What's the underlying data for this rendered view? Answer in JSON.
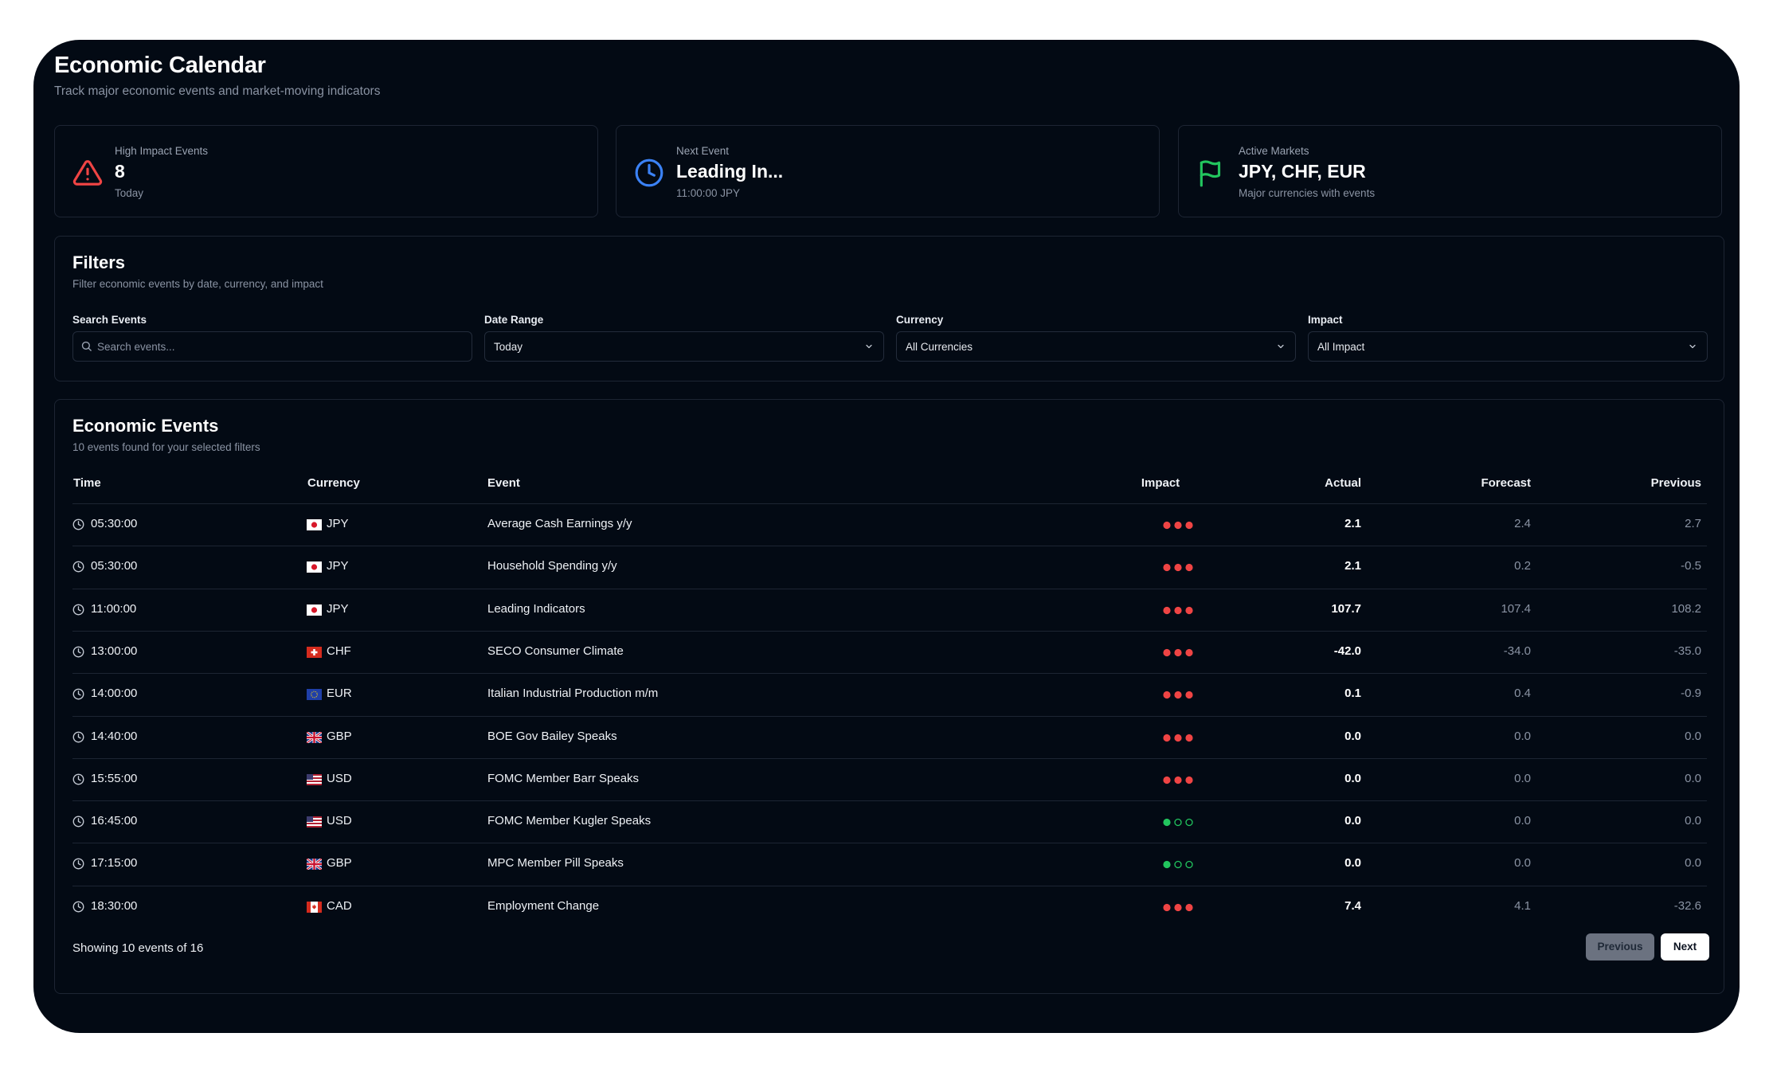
{
  "header": {
    "title": "Economic Calendar",
    "subtitle": "Track major economic events and market-moving indicators"
  },
  "stats": [
    {
      "label": "High Impact Events",
      "value": "8",
      "sub": "Today",
      "icon": "warning-triangle-icon",
      "color": "#ef4444"
    },
    {
      "label": "Next Event",
      "value": "Leading In...",
      "sub": "11:00:00 JPY",
      "icon": "clock-icon",
      "color": "#3b82f6"
    },
    {
      "label": "Active Markets",
      "value": "JPY, CHF, EUR",
      "sub": "Major currencies with events",
      "icon": "flag-icon",
      "color": "#22c55e"
    }
  ],
  "filters": {
    "title": "Filters",
    "subtitle": "Filter economic events by date, currency, and impact",
    "search": {
      "label": "Search Events",
      "placeholder": "Search events..."
    },
    "date_range": {
      "label": "Date Range",
      "value": "Today"
    },
    "currency": {
      "label": "Currency",
      "value": "All Currencies"
    },
    "impact": {
      "label": "Impact",
      "value": "All Impact"
    }
  },
  "events": {
    "title": "Economic Events",
    "subtitle": "10 events found for your selected filters",
    "columns": {
      "time": "Time",
      "currency": "Currency",
      "event": "Event",
      "impact": "Impact",
      "actual": "Actual",
      "forecast": "Forecast",
      "previous": "Previous"
    },
    "rows": [
      {
        "time": "05:30:00",
        "currency": "JPY",
        "flag": "jp",
        "event": "Average Cash Earnings y/y",
        "impact": 3,
        "actual": "2.1",
        "forecast": "2.4",
        "previous": "2.7"
      },
      {
        "time": "05:30:00",
        "currency": "JPY",
        "flag": "jp",
        "event": "Household Spending y/y",
        "impact": 3,
        "actual": "2.1",
        "forecast": "0.2",
        "previous": "-0.5"
      },
      {
        "time": "11:00:00",
        "currency": "JPY",
        "flag": "jp",
        "event": "Leading Indicators",
        "impact": 3,
        "actual": "107.7",
        "forecast": "107.4",
        "previous": "108.2"
      },
      {
        "time": "13:00:00",
        "currency": "CHF",
        "flag": "ch",
        "event": "SECO Consumer Climate",
        "impact": 3,
        "actual": "-42.0",
        "forecast": "-34.0",
        "previous": "-35.0"
      },
      {
        "time": "14:00:00",
        "currency": "EUR",
        "flag": "eu",
        "event": "Italian Industrial Production m/m",
        "impact": 3,
        "actual": "0.1",
        "forecast": "0.4",
        "previous": "-0.9"
      },
      {
        "time": "14:40:00",
        "currency": "GBP",
        "flag": "gb",
        "event": "BOE Gov Bailey Speaks",
        "impact": 3,
        "actual": "0.0",
        "forecast": "0.0",
        "previous": "0.0"
      },
      {
        "time": "15:55:00",
        "currency": "USD",
        "flag": "us",
        "event": "FOMC Member Barr Speaks",
        "impact": 3,
        "actual": "0.0",
        "forecast": "0.0",
        "previous": "0.0"
      },
      {
        "time": "16:45:00",
        "currency": "USD",
        "flag": "us",
        "event": "FOMC Member Kugler Speaks",
        "impact": 1,
        "actual": "0.0",
        "forecast": "0.0",
        "previous": "0.0"
      },
      {
        "time": "17:15:00",
        "currency": "GBP",
        "flag": "gb",
        "event": "MPC Member Pill Speaks",
        "impact": 1,
        "actual": "0.0",
        "forecast": "0.0",
        "previous": "0.0"
      },
      {
        "time": "18:30:00",
        "currency": "CAD",
        "flag": "ca",
        "event": "Employment Change",
        "impact": 3,
        "actual": "7.4",
        "forecast": "4.1",
        "previous": "-32.6"
      }
    ],
    "footer": "Showing 10 events of 16",
    "prev_label": "Previous",
    "next_label": "Next"
  },
  "colors": {
    "background": "#030a14",
    "high_impact": "#ef4444",
    "low_impact": "#22c55e",
    "border": "#1d2533"
  }
}
